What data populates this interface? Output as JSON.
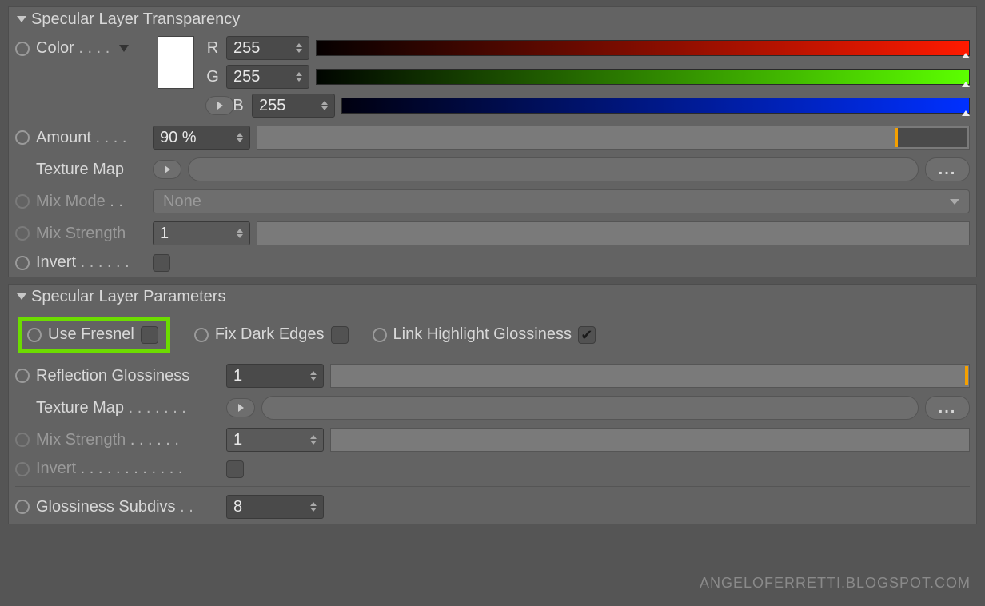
{
  "transparency": {
    "title": "Specular Layer Transparency",
    "color": {
      "label": "Color",
      "r_value": "255",
      "g_value": "255",
      "b_value": "255",
      "r": "R",
      "g": "G",
      "b": "B"
    },
    "amount": {
      "label": "Amount",
      "value": "90 %",
      "percent": 90
    },
    "texture_map": {
      "label": "Texture Map"
    },
    "mix_mode": {
      "label": "Mix Mode",
      "value": "None"
    },
    "mix_strength": {
      "label": "Mix Strength",
      "value": "1",
      "percent": 100
    },
    "invert": {
      "label": "Invert",
      "checked": false
    }
  },
  "params": {
    "title": "Specular Layer Parameters",
    "use_fresnel": {
      "label": "Use Fresnel",
      "checked": false
    },
    "fix_dark_edges": {
      "label": "Fix Dark Edges",
      "checked": false
    },
    "link_highlight": {
      "label": "Link Highlight Glossiness",
      "checked": true
    },
    "reflection_gloss": {
      "label": "Reflection Glossiness",
      "value": "1",
      "percent": 100
    },
    "texture_map": {
      "label": "Texture Map"
    },
    "mix_strength": {
      "label": "Mix Strength",
      "value": "1",
      "percent": 100
    },
    "invert": {
      "label": "Invert",
      "checked": false
    },
    "glossiness_subdivs": {
      "label": "Glossiness Subdivs",
      "value": "8"
    }
  },
  "misc": {
    "ellipsis": "...",
    "watermark": "ANGELOFERRETTI.BLOGSPOT.COM"
  }
}
